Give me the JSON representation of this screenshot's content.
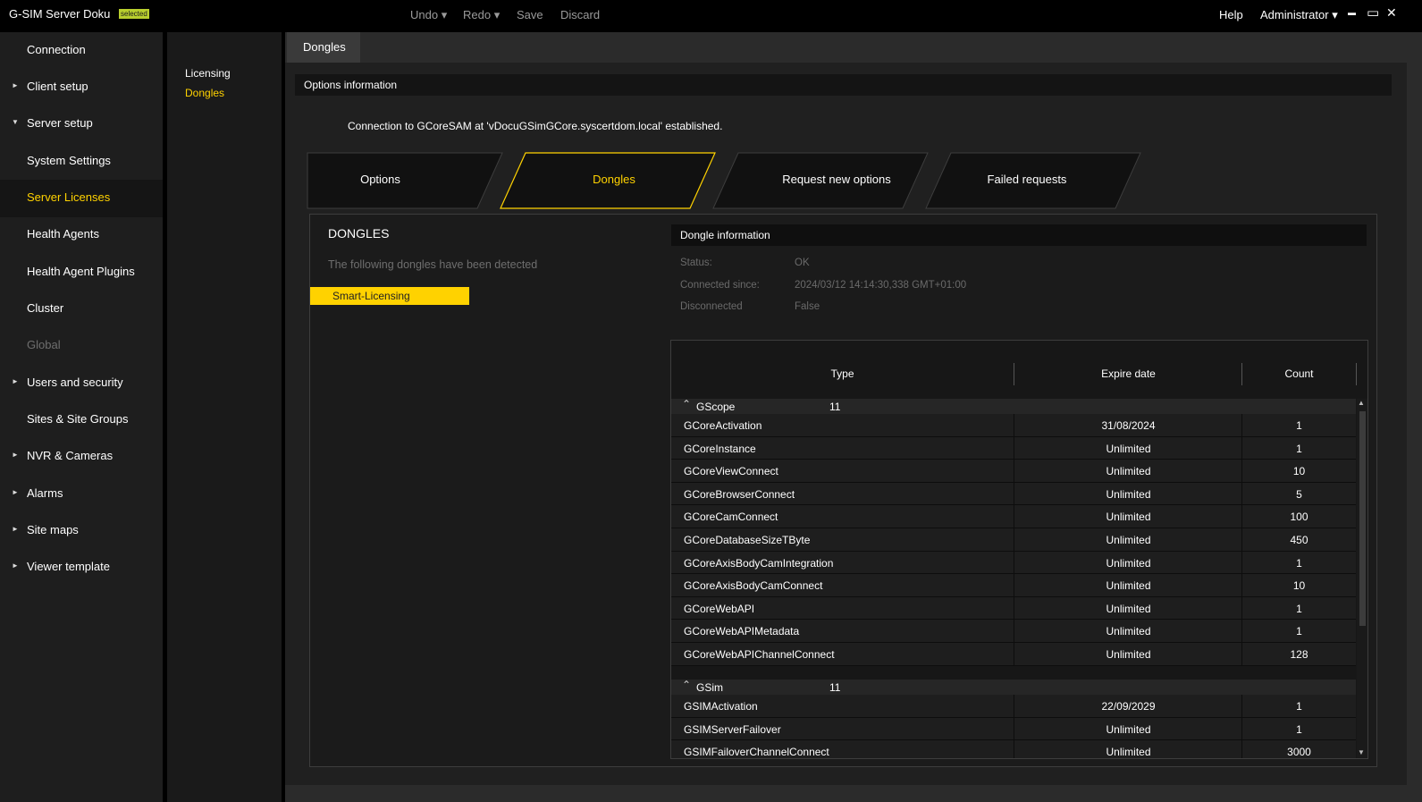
{
  "titlebar": {
    "app_title": "G-SIM Server Doku",
    "badge": "selected",
    "undo": "Undo ▾",
    "redo": "Redo ▾",
    "save": "Save",
    "discard": "Discard",
    "help": "Help",
    "user": "Administrator ▾",
    "minimize": "▬",
    "maximize": "▭",
    "close": "✕"
  },
  "sidebar": {
    "items": [
      {
        "label": "Connection",
        "arrow": ""
      },
      {
        "label": "Client setup",
        "arrow": "►"
      },
      {
        "label": "Server setup",
        "arrow": "▼"
      },
      {
        "label": "System Settings",
        "arrow": ""
      },
      {
        "label": "Server Licenses",
        "arrow": ""
      },
      {
        "label": "Health Agents",
        "arrow": ""
      },
      {
        "label": "Health Agent Plugins",
        "arrow": ""
      },
      {
        "label": "Cluster",
        "arrow": ""
      },
      {
        "label": "Global",
        "arrow": ""
      },
      {
        "label": "Users and security",
        "arrow": "►"
      },
      {
        "label": "Sites & Site Groups",
        "arrow": ""
      },
      {
        "label": "NVR & Cameras",
        "arrow": "►"
      },
      {
        "label": "Alarms",
        "arrow": "►"
      },
      {
        "label": "Site maps",
        "arrow": "►"
      },
      {
        "label": "Viewer template",
        "arrow": "►"
      }
    ]
  },
  "subnav": {
    "items": [
      {
        "label": "Licensing"
      },
      {
        "label": "Dongles"
      }
    ]
  },
  "main": {
    "tab": "Dongles",
    "options_header": "Options information",
    "connection_message": "Connection to GCoreSAM at 'vDocuGSimGCore.syscertdom.local' established.",
    "tabs": [
      {
        "label": "Options"
      },
      {
        "label": "Dongles"
      },
      {
        "label": "Request new options"
      },
      {
        "label": "Failed requests"
      }
    ],
    "dongles_title": "DONGLES",
    "dongles_subtitle": "The following dongles have been detected",
    "dongle_name": "Smart-Licensing",
    "dongle_info": {
      "header": "Dongle information",
      "rows": [
        {
          "label": "Status:",
          "value": "OK"
        },
        {
          "label": "Connected since:",
          "value": "2024/03/12 14:14:30,338 GMT+01:00"
        },
        {
          "label": "Disconnected",
          "value": "False"
        }
      ]
    },
    "table": {
      "headers": {
        "type": "Type",
        "expire": "Expire date",
        "count": "Count"
      },
      "groups": [
        {
          "name": "GScope",
          "count": "11",
          "rows": [
            {
              "type": "GCoreActivation",
              "expire": "31/08/2024",
              "count": "1"
            },
            {
              "type": "GCoreInstance",
              "expire": "Unlimited",
              "count": "1"
            },
            {
              "type": "GCoreViewConnect",
              "expire": "Unlimited",
              "count": "10"
            },
            {
              "type": "GCoreBrowserConnect",
              "expire": "Unlimited",
              "count": "5"
            },
            {
              "type": "GCoreCamConnect",
              "expire": "Unlimited",
              "count": "100"
            },
            {
              "type": "GCoreDatabaseSizeTByte",
              "expire": "Unlimited",
              "count": "450"
            },
            {
              "type": "GCoreAxisBodyCamIntegration",
              "expire": "Unlimited",
              "count": "1"
            },
            {
              "type": "GCoreAxisBodyCamConnect",
              "expire": "Unlimited",
              "count": "10"
            },
            {
              "type": "GCoreWebAPI",
              "expire": "Unlimited",
              "count": "1"
            },
            {
              "type": "GCoreWebAPIMetadata",
              "expire": "Unlimited",
              "count": "1"
            },
            {
              "type": "GCoreWebAPIChannelConnect",
              "expire": "Unlimited",
              "count": "128"
            }
          ]
        },
        {
          "name": "GSim",
          "count": "11",
          "rows": [
            {
              "type": "GSIMActivation",
              "expire": "22/09/2029",
              "count": "1"
            },
            {
              "type": "GSIMServerFailover",
              "expire": "Unlimited",
              "count": "1"
            },
            {
              "type": "GSIMFailoverChannelConnect",
              "expire": "Unlimited",
              "count": "3000"
            }
          ]
        }
      ]
    }
  },
  "colors": {
    "accent": "#ffd200",
    "badge": "#b9cf2e"
  }
}
